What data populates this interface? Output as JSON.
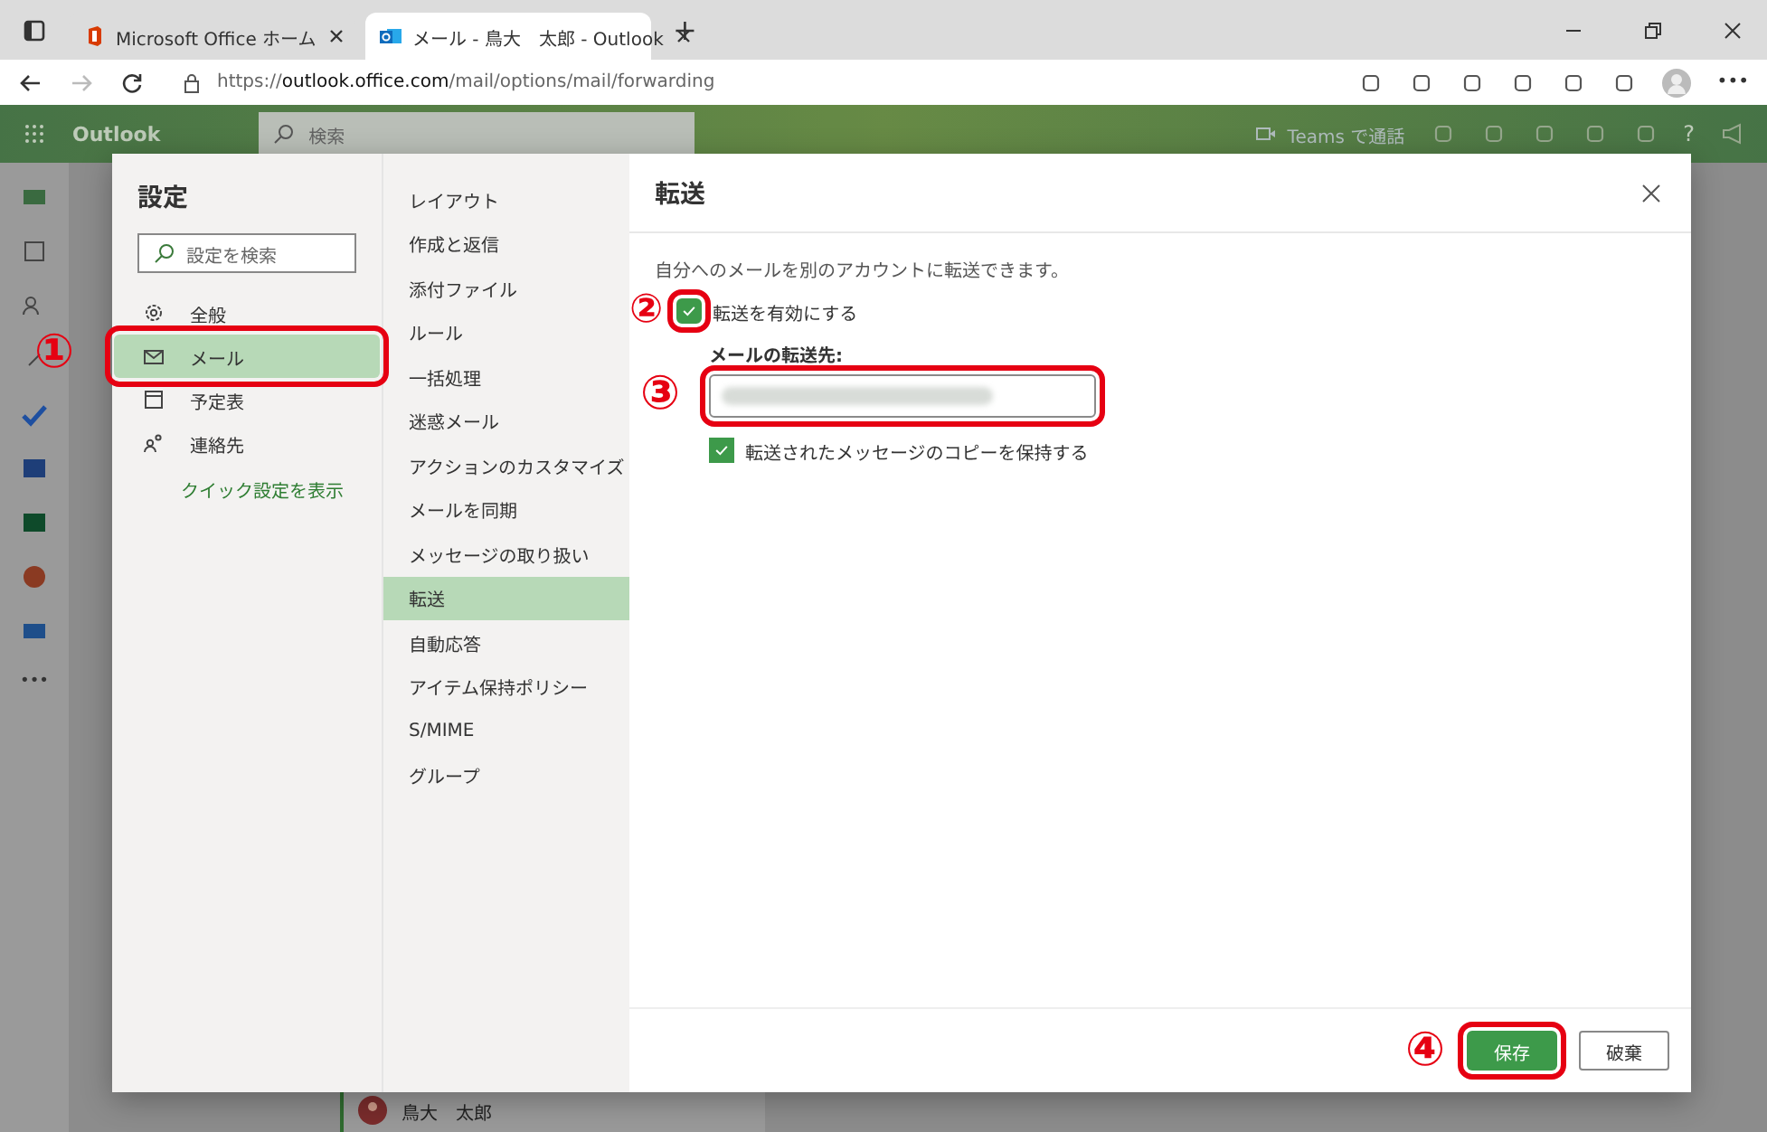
{
  "browser": {
    "tabs": [
      {
        "title": "Microsoft Office ホーム",
        "selected": false
      },
      {
        "title": "メール - 鳥大　太郎 - Outlook",
        "selected": true
      }
    ],
    "new_tab": "+",
    "url_scheme": "https://",
    "url_host": "outlook.office.com",
    "url_path": "/mail/options/mail/forwarding"
  },
  "app": {
    "name": "Outlook",
    "search_placeholder": "検索",
    "teams_label": "Teams で通話",
    "help": "?"
  },
  "rail_more": "•••",
  "message_sender": "鳥大　太郎",
  "settings": {
    "title": "設定",
    "search_placeholder": "設定を検索",
    "categories": [
      {
        "label": "全般",
        "selected": false
      },
      {
        "label": "メール",
        "selected": true,
        "marker": "①"
      },
      {
        "label": "予定表",
        "selected": false
      },
      {
        "label": "連絡先",
        "selected": false
      }
    ],
    "quick_link": "クイック設定を表示"
  },
  "subcategories": [
    {
      "label": "レイアウト",
      "selected": false
    },
    {
      "label": "作成と返信",
      "selected": false
    },
    {
      "label": "添付ファイル",
      "selected": false
    },
    {
      "label": "ルール",
      "selected": false
    },
    {
      "label": "一括処理",
      "selected": false
    },
    {
      "label": "迷惑メール",
      "selected": false
    },
    {
      "label": "アクションのカスタマイズ",
      "selected": false
    },
    {
      "label": "メールを同期",
      "selected": false
    },
    {
      "label": "メッセージの取り扱い",
      "selected": false
    },
    {
      "label": "転送",
      "selected": true
    },
    {
      "label": "自動応答",
      "selected": false
    },
    {
      "label": "アイテム保持ポリシー",
      "selected": false
    },
    {
      "label": "S/MIME",
      "selected": false
    },
    {
      "label": "グループ",
      "selected": false
    }
  ],
  "panel": {
    "title": "転送",
    "description": "自分へのメールを別のアカウントに転送できます。",
    "enable": {
      "label": "転送を有効にする",
      "checked": true,
      "marker": "②"
    },
    "address_label": "メールの転送先:",
    "address_marker": "③",
    "keep_copy": {
      "label": "転送されたメッセージのコピーを保持する",
      "checked": true
    },
    "buttons": [
      {
        "label": "保存",
        "kind": "primary",
        "marker": "④"
      },
      {
        "label": "破棄",
        "kind": "secondary"
      }
    ]
  }
}
